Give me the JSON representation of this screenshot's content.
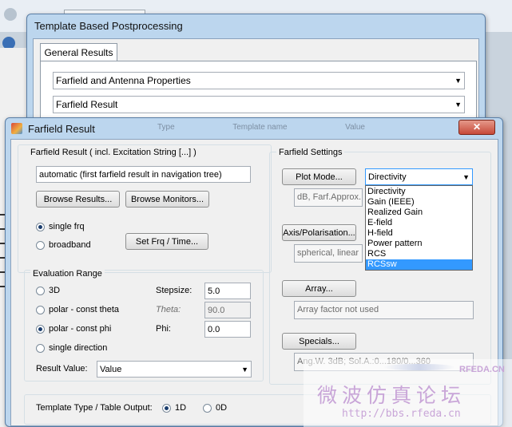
{
  "template_window": {
    "title": "Template Based Postprocessing",
    "tab": "General Results",
    "combo1": "Farfield and Antenna Properties",
    "combo2": "Farfield Result"
  },
  "farfield_window": {
    "title": "Farfield Result",
    "close": "✕",
    "background_headers": [
      "Type",
      "Template name",
      "Value"
    ],
    "result": {
      "label": "Farfield Result ( incl. Excitation String [...] )",
      "value": "automatic (first farfield result in navigation tree)",
      "browse_results": "Browse Results...",
      "browse_monitors": "Browse Monitors...",
      "single_frq": "single frq",
      "broadband": "broadband",
      "set_frq": "Set Frq / Time..."
    },
    "evaluation": {
      "title": "Evaluation Range",
      "opt_3d": "3D",
      "opt_theta": "polar - const theta",
      "opt_phi": "polar - const phi",
      "opt_single": "single direction",
      "stepsize_label": "Stepsize:",
      "stepsize_value": "5.0",
      "theta_label": "Theta:",
      "theta_value": "90.0",
      "phi_label": "Phi:",
      "phi_value": "0.0",
      "result_value_label": "Result Value:",
      "result_value": "Value"
    },
    "settings": {
      "title": "Farfield Settings",
      "plot_mode": "Plot Mode...",
      "plot_mode_value": "Directivity",
      "plot_mode_info": "dB, Farf.Approx.",
      "dropdown_options": [
        "Directivity",
        "Gain (IEEE)",
        "Realized Gain",
        "E-field",
        "H-field",
        "Power pattern",
        "RCS",
        "RCSsw"
      ],
      "dropdown_selected": "RCSsw",
      "axis": "Axis/Polarisation...",
      "axis_info": "spherical, linear",
      "array": "Array...",
      "array_info": "Array factor not used",
      "specials": "Specials...",
      "specials_info": "Ang.W. 3dB; Sol.A.:0...180/0...360"
    },
    "template_type": {
      "label": "Template Type / Table Output:",
      "opt_1d": "1D",
      "opt_0d": "0D"
    }
  },
  "watermark": {
    "brand": "RFEDA.CN",
    "chinese": "微波仿真论坛",
    "url": "http://bbs.rfeda.cn"
  },
  "colors": {
    "title_bar": "#bcd6ee",
    "selection": "#3399ff",
    "watermark": "#c9a6d8"
  }
}
